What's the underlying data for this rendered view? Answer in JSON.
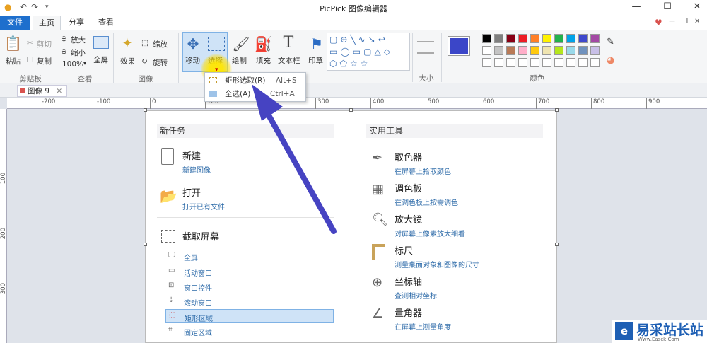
{
  "window": {
    "title": "PicPick 图像编辑器"
  },
  "menu_tabs": [
    "文件",
    "主页",
    "分享",
    "查看"
  ],
  "ribbon": {
    "clipboard": {
      "paste": "粘贴",
      "cut": "剪切",
      "copy": "复制",
      "group": "剪贴板"
    },
    "view": {
      "zoom_in": "放大",
      "zoom_out": "缩小",
      "zoom_level": "100%",
      "fullscreen": "全屏",
      "group": "查看"
    },
    "image": {
      "effects": "效果",
      "resize": "缩放",
      "rotate": "旋转",
      "group": "图像"
    },
    "tools": {
      "move": "移动",
      "select": "选择",
      "draw": "绘制",
      "fill": "填充",
      "textbox": "文本框",
      "stamp": "印章"
    },
    "size": {
      "group": "大小"
    },
    "colors": {
      "group": "颜色",
      "primary": "#3b46c8",
      "palette_row1": [
        "#000000",
        "#7f7f7f",
        "#880015",
        "#ed1c24",
        "#ff7f27",
        "#fff200",
        "#22b14c",
        "#00a2e8",
        "#3f48cc",
        "#a349a4"
      ],
      "palette_row2": [
        "#ffffff",
        "#c3c3c3",
        "#b97a57",
        "#ffaec9",
        "#ffc90e",
        "#efe4b0",
        "#b5e61d",
        "#99d9ea",
        "#7092be",
        "#c8bfe7"
      ],
      "palette_row3": [
        "#ffffff",
        "#ffffff",
        "#ffffff",
        "#ffffff",
        "#ffffff",
        "#ffffff",
        "#ffffff",
        "#ffffff",
        "#ffffff",
        "#ffffff"
      ]
    }
  },
  "select_menu": {
    "rect": {
      "label": "矩形选取(R)",
      "shortcut": "Alt+S"
    },
    "all": {
      "label": "全选(A)",
      "shortcut": "Ctrl+A"
    }
  },
  "doc_tab": "图像 9",
  "ruler_h": [
    "-200",
    "-100",
    "0",
    "100",
    "200",
    "300",
    "400",
    "500",
    "600",
    "700",
    "800",
    "900"
  ],
  "ruler_v": [
    "100",
    "200",
    "300"
  ],
  "new_task": {
    "header": "新任务",
    "new": {
      "title": "新建",
      "sub": "新建图像"
    },
    "open": {
      "title": "打开",
      "sub": "打开已有文件"
    },
    "capture": {
      "title": "截取屏幕"
    },
    "capture_items": [
      "全屏",
      "活动窗口",
      "窗口控件",
      "滚动窗口",
      "矩形区域",
      "固定区域"
    ]
  },
  "utilities": {
    "header": "实用工具",
    "items": [
      {
        "title": "取色器",
        "sub": "在屏幕上拾取颜色"
      },
      {
        "title": "调色板",
        "sub": "在调色板上按需调色"
      },
      {
        "title": "放大镜",
        "sub": "对屏幕上像素放大细看"
      },
      {
        "title": "标尺",
        "sub": "测量桌面对象和图像的尺寸"
      },
      {
        "title": "坐标轴",
        "sub": "查测相对坐标"
      },
      {
        "title": "量角器",
        "sub": "在屏幕上测量角度"
      }
    ]
  },
  "watermark": {
    "text": "易采站长站",
    "sub": "Www.Easck.Com"
  }
}
